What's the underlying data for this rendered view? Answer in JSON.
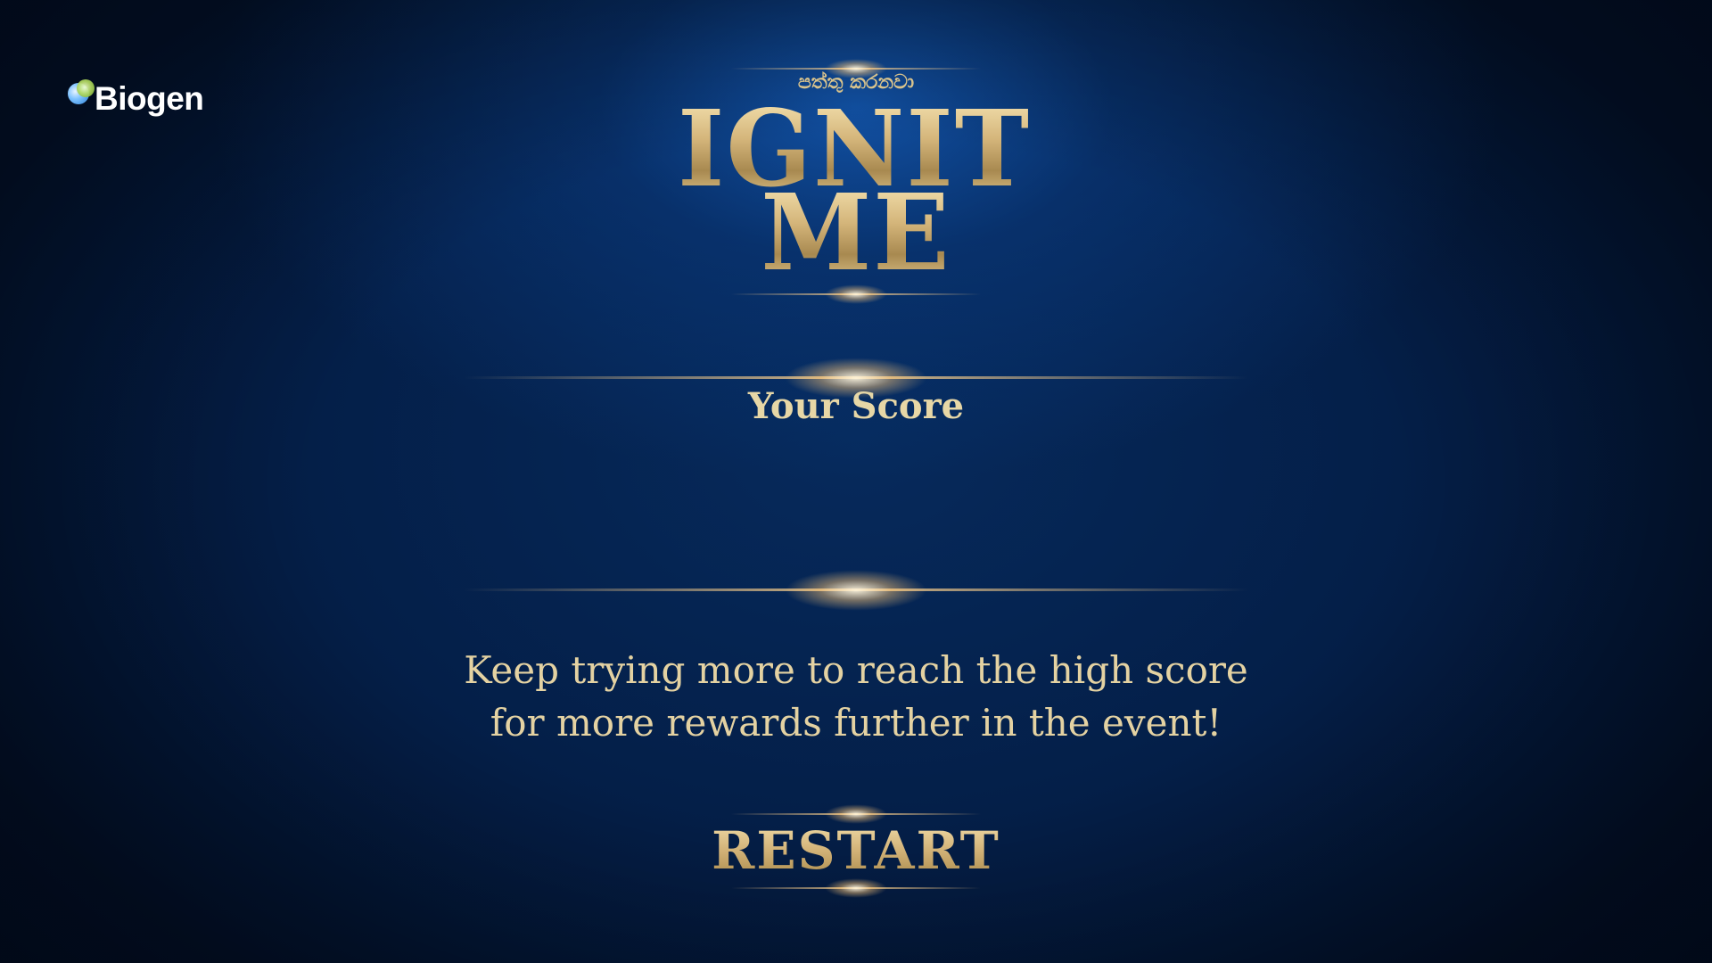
{
  "brand": {
    "logo_text": "Biogen",
    "logo_icon": "biogen-circles-icon"
  },
  "title": {
    "sinhala_tagline": "පත්තු කරනවා",
    "line1": "IGNITE",
    "line2": "ME"
  },
  "score": {
    "label": "Your Score",
    "value": ""
  },
  "message": {
    "line1": "Keep trying more to reach the high score",
    "line2": "for more rewards further in the event!"
  },
  "actions": {
    "restart_label": "RESTART"
  },
  "colors": {
    "gold": "#d9c38c",
    "background_deep": "#02102a",
    "background_glow": "#145ab4"
  }
}
